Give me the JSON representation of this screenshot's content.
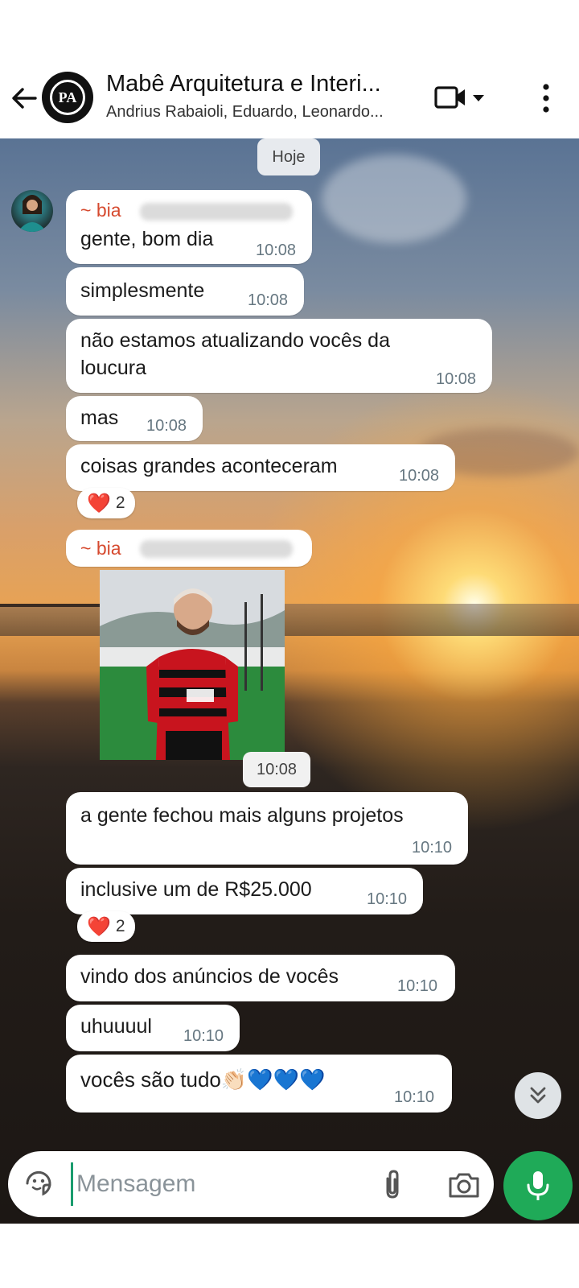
{
  "header": {
    "title": "Mabê Arquitetura e Interi...",
    "subtitle": "Andrius Rabaioli, Eduardo, Leonardo...",
    "avatar_text": "PA",
    "icons": [
      "back-arrow-icon",
      "video-call-icon",
      "dropdown-arrow-icon",
      "more-options-icon"
    ]
  },
  "chat": {
    "day_label": "Hoje",
    "messages": [
      {
        "sender": "~ bia",
        "text": "gente, bom dia",
        "time": "10:08"
      },
      {
        "text": "simplesmente",
        "time": "10:08"
      },
      {
        "text": "não estamos atualizando vocês da loucura",
        "time": "10:08"
      },
      {
        "text": "mas",
        "time": "10:08"
      },
      {
        "text": "coisas grandes aconteceram",
        "time": "10:08",
        "reaction": {
          "emoji": "❤️",
          "count": "2"
        }
      },
      {
        "sender": "~ bia",
        "type": "image",
        "time": "10:08",
        "image_alt": "Homem com camisa do Flamengo"
      },
      {
        "text": "a gente fechou mais alguns projetos",
        "time": "10:10"
      },
      {
        "text": "inclusive um de R$25.000",
        "time": "10:10",
        "reaction": {
          "emoji": "❤️",
          "count": "2"
        }
      },
      {
        "text": "vindo dos anúncios de vocês",
        "time": "10:10"
      },
      {
        "text": "uhuuuul",
        "time": "10:10"
      },
      {
        "text": "vocês são tudo👏🏻💙💙💙",
        "time": "10:10"
      }
    ]
  },
  "input": {
    "placeholder": "Mensagem",
    "icons": [
      "sticker-icon",
      "attach-icon",
      "camera-icon",
      "mic-icon"
    ]
  },
  "colors": {
    "sender_name": "#d64a2f",
    "mic_button": "#1faa58",
    "timestamp": "#667781",
    "cursor": "#1a9c6e"
  }
}
